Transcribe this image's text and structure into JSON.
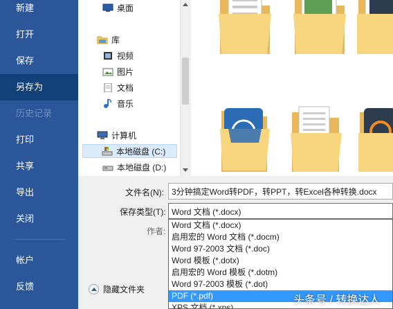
{
  "backstage": {
    "items": [
      {
        "label": "新建"
      },
      {
        "label": "打开"
      },
      {
        "label": "保存"
      },
      {
        "label": "另存为"
      },
      {
        "label": "历史记录"
      },
      {
        "label": "打印"
      },
      {
        "label": "共享"
      },
      {
        "label": "导出"
      },
      {
        "label": "关闭"
      },
      {
        "label": "帐户"
      },
      {
        "label": "反馈"
      }
    ],
    "active_item": "另存为",
    "disabled_item": "历史记录"
  },
  "nav": {
    "items": [
      {
        "label": "桌面",
        "icon": "desktop-icon"
      },
      {
        "label": "库",
        "icon": "library-icon"
      },
      {
        "label": "视频",
        "icon": "video-icon"
      },
      {
        "label": "图片",
        "icon": "picture-icon"
      },
      {
        "label": "文档",
        "icon": "document-icon"
      },
      {
        "label": "音乐",
        "icon": "music-icon"
      },
      {
        "label": "计算机",
        "icon": "computer-icon"
      },
      {
        "label": "本地磁盘 (C:)",
        "icon": "drive-c-icon"
      },
      {
        "label": "本地磁盘 (D:)",
        "icon": "drive-d-icon"
      }
    ],
    "selected": "本地磁盘 (C:)"
  },
  "form": {
    "filename_label": "文件名(N):",
    "filename_value": "3分钟搞定Word转PDF，转PPT，转Excel各种转换.docx",
    "type_label": "保存类型(T):",
    "type_value": "Word 文档 (*.docx)",
    "author_label": "作者:"
  },
  "dropdown": {
    "options": [
      "Word 文档 (*.docx)",
      "启用宏的 Word 文档 (*.docm)",
      "Word 97-2003 文档 (*.doc)",
      "Word 模板 (*.dotx)",
      "启用宏的 Word 模板 (*.dotm)",
      "Word 97-2003 模板 (*.dot)",
      "PDF (*.pdf)",
      "XPS 文档 (*.xps)"
    ],
    "selected": "PDF (*.pdf)"
  },
  "hide_folders_label": "隐藏文件夹",
  "watermark": "头条号 / 转换达人",
  "colors": {
    "backstage_bg": "#2b579a",
    "backstage_active": "#124078",
    "selection": "#3399ff"
  }
}
